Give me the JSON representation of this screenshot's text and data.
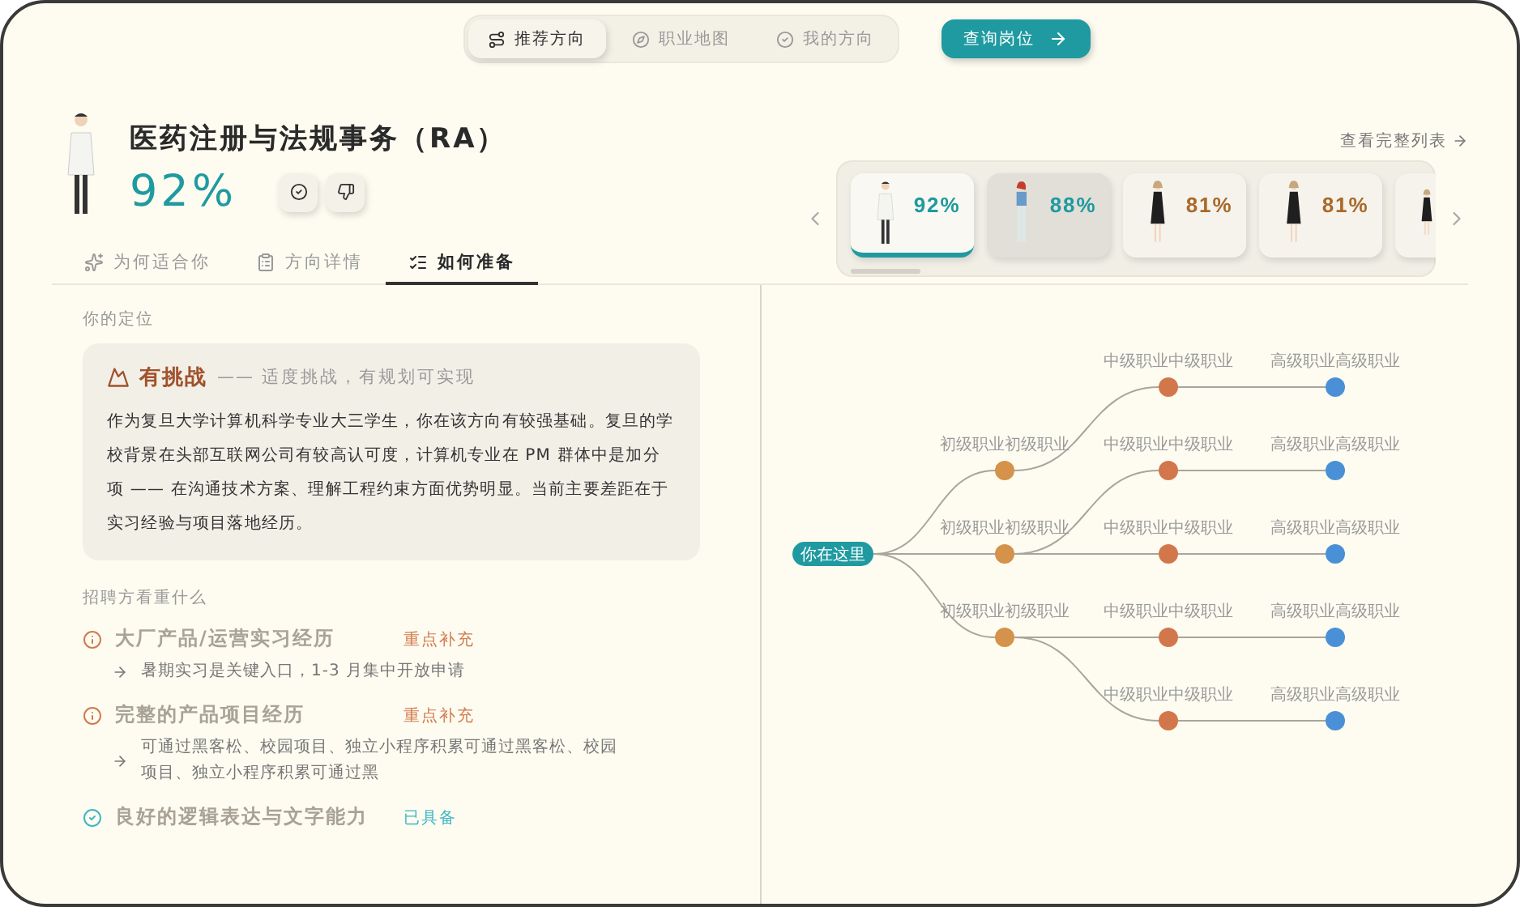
{
  "nav": {
    "tabs": [
      {
        "label": "推荐方向",
        "selected": true
      },
      {
        "label": "职业地图",
        "selected": false
      },
      {
        "label": "我的方向",
        "selected": false
      }
    ],
    "action": "查询岗位"
  },
  "direction": {
    "title": "医药注册与法规事务（RA）",
    "match": "92%"
  },
  "carousel": {
    "link": "查看完整列表",
    "cards": [
      {
        "match": "92%",
        "color": "#1f9aa0",
        "selected": true,
        "hovered": false
      },
      {
        "match": "88%",
        "color": "#1f9aa0",
        "selected": false,
        "hovered": true
      },
      {
        "match": "81%",
        "color": "#a8692a",
        "selected": false,
        "hovered": false
      },
      {
        "match": "81%",
        "color": "#a8692a",
        "selected": false,
        "hovered": false
      },
      {
        "selected": false,
        "hovered": false
      }
    ]
  },
  "tabs": [
    {
      "label": "为何适合你",
      "selected": false
    },
    {
      "label": "方向详情",
      "selected": false
    },
    {
      "label": "如何准备",
      "selected": true
    }
  ],
  "positioning": {
    "heading": "你的定位",
    "level": "有挑战",
    "subtitle": "—— 适度挑战，有规划可实现",
    "text": "作为复旦大学计算机科学专业大三学生，你在该方向有较强基础。复旦的学校背景在头部互联网公司有较高认可度，计算机专业在 PM 群体中是加分项 —— 在沟通技术方案、理解工程约束方面优势明显。当前主要差距在于实习经验与项目落地经历。"
  },
  "requirements": {
    "heading": "招聘方看重什么",
    "items": [
      {
        "kind": "gap",
        "title": "大厂产品/运营实习经历",
        "status": "重点补充",
        "note": "暑期实习是关键入口，1-3 月集中开放申请"
      },
      {
        "kind": "gap",
        "title": "完整的产品项目经历",
        "status": "重点补充",
        "note": "可通过黑客松、校园项目、独立小程序积累可通过黑客松、校园项目、独立小程序积累可通过黑"
      },
      {
        "kind": "have",
        "title": "良好的逻辑表达与文字能力",
        "status": "已具备"
      }
    ]
  },
  "career_map": {
    "root": "你在这里",
    "children": [
      {
        "label": "初级职业初级职业",
        "color": "#d4924a",
        "children": [
          {
            "label": "中级职业中级职业",
            "color": "#d2774b",
            "children": [
              {
                "label": "高级职业高级职业",
                "color": "#4a90d6"
              }
            ]
          }
        ]
      },
      {
        "label": "初级职业初级职业",
        "color": "#d4924a",
        "children": [
          {
            "label": "中级职业中级职业",
            "color": "#d2774b",
            "children": [
              {
                "label": "高级职业高级职业",
                "color": "#4a90d6"
              }
            ]
          },
          {
            "label": "中级职业中级职业",
            "color": "#d2774b",
            "children": [
              {
                "label": "高级职业高级职业",
                "color": "#4a90d6"
              }
            ]
          }
        ]
      },
      {
        "label": "初级职业初级职业",
        "color": "#d4924a",
        "children": [
          {
            "label": "中级职业中级职业",
            "color": "#d2774b",
            "children": [
              {
                "label": "高级职业高级职业",
                "color": "#4a90d6"
              }
            ]
          },
          {
            "label": "中级职业中级职业",
            "color": "#d2774b",
            "children": [
              {
                "label": "高级职业高级职业",
                "color": "#4a90d6"
              }
            ]
          }
        ]
      }
    ]
  }
}
